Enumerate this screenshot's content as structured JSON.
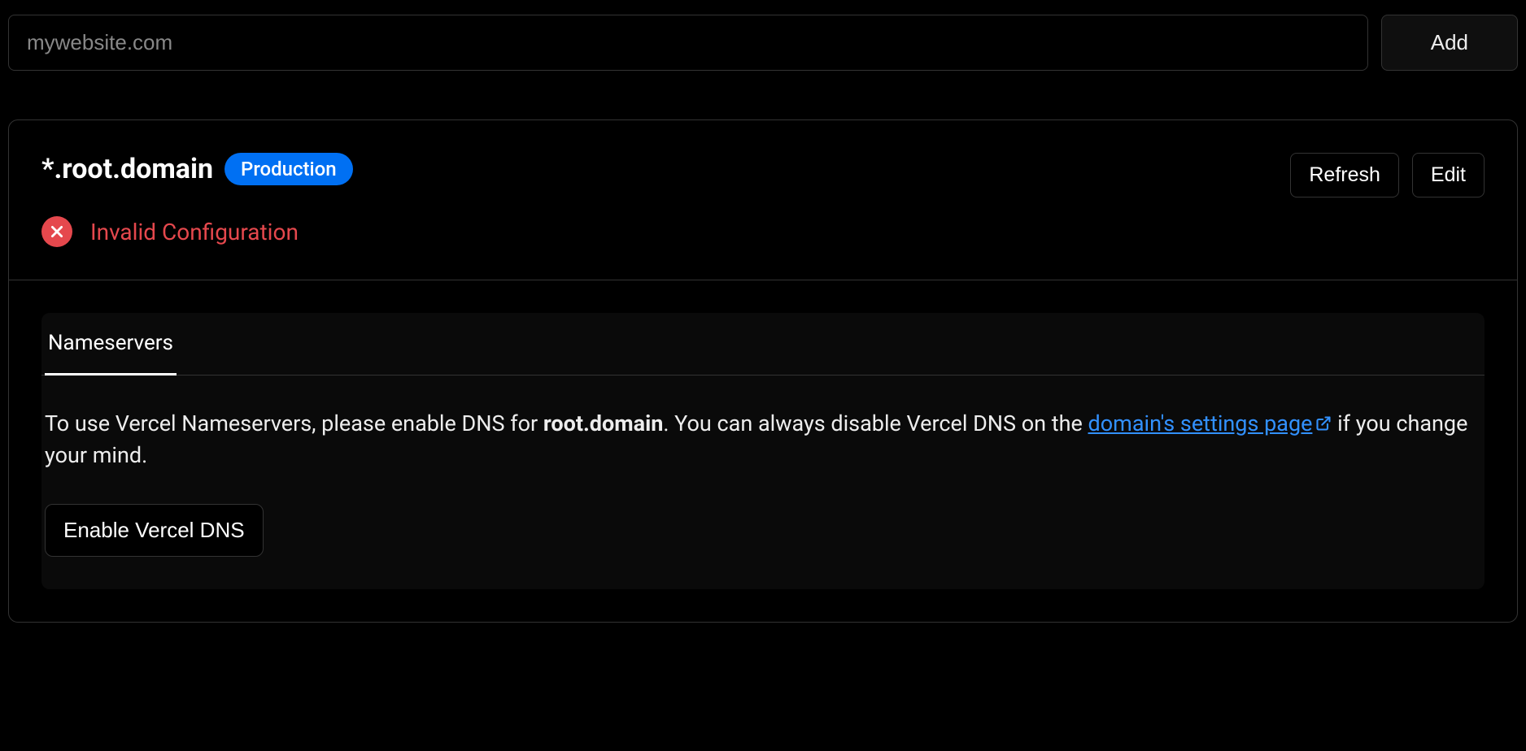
{
  "topRow": {
    "input_placeholder": "mywebsite.com",
    "add_label": "Add"
  },
  "card": {
    "domain_name": "*.root.domain",
    "badge_label": "Production",
    "refresh_label": "Refresh",
    "edit_label": "Edit",
    "status": {
      "icon": "error-icon",
      "text": "Invalid Configuration",
      "color": "#e5484d"
    },
    "tabs": [
      {
        "label": "Nameservers",
        "active": true
      }
    ],
    "description": {
      "part1": "To use Vercel Nameservers, please enable DNS for ",
      "bold_domain": "root.domain",
      "part2": ". You can always disable Vercel DNS on the ",
      "link_text": "domain's settings page",
      "part3": " if you change your mind."
    },
    "enable_label": "Enable Vercel DNS"
  }
}
